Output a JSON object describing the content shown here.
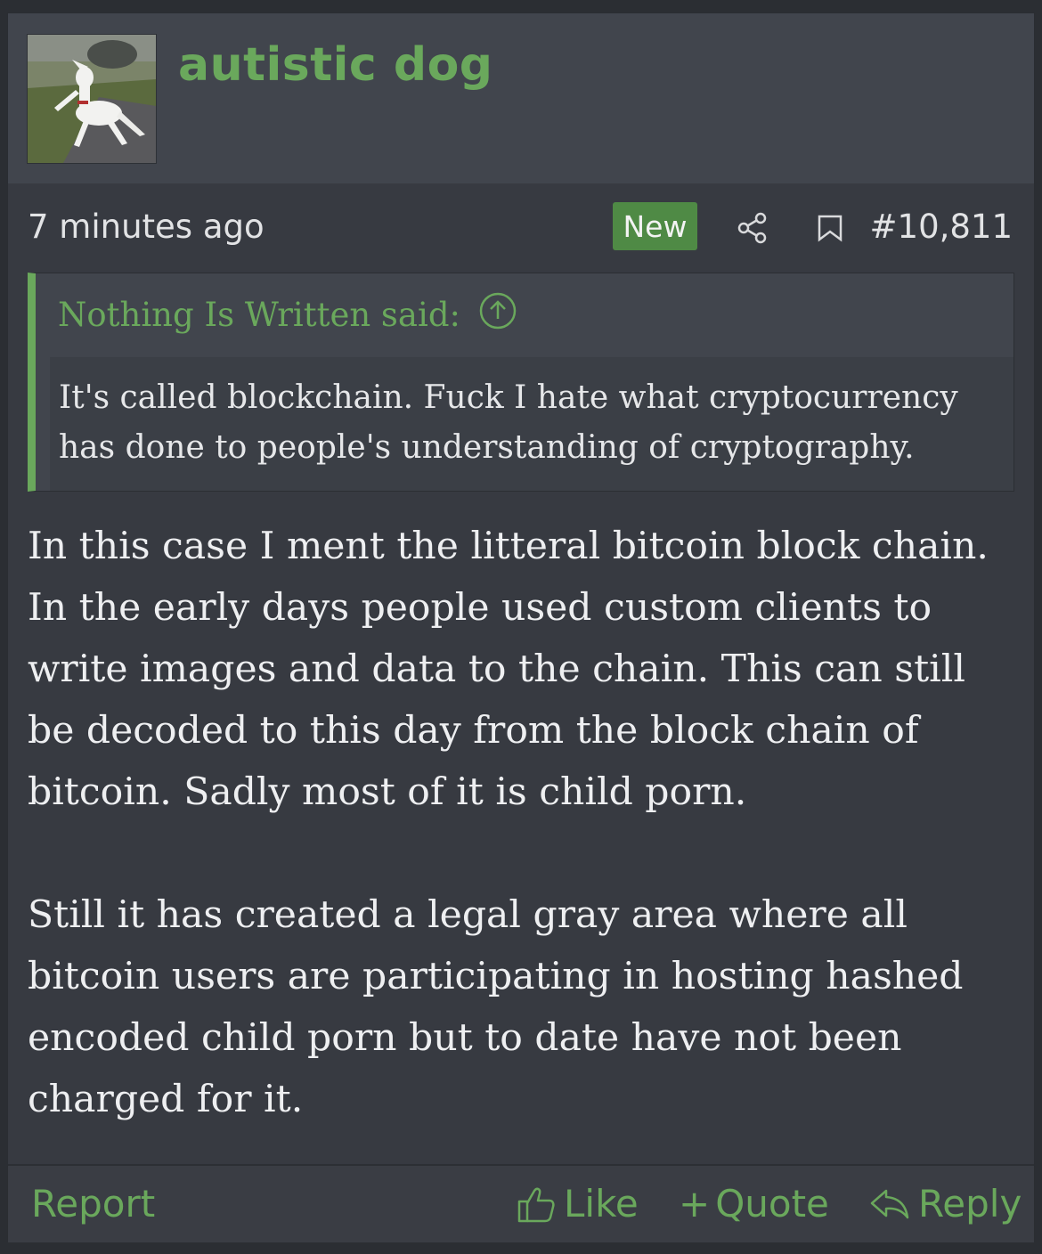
{
  "post": {
    "username": "autistic dog",
    "avatar_alt": "avatar-photo-white-dog",
    "timestamp": "7 minutes ago",
    "new_badge": "New",
    "post_number": "#10,811",
    "quote": {
      "author_line": "Nothing Is Written said:",
      "text": "It's called blockchain. Fuck I hate what cryptocurrency has done to people's understanding of cryptography."
    },
    "body": [
      "In this case I ment the litteral bitcoin block chain. In the early days people used custom clients to write images and data to the chain. This can still be decoded to this day from the block chain of bitcoin. Sadly most of it is child porn.",
      "Still it has created a legal gray area where all bitcoin users are participating in hosting hashed encoded child porn but to date have not been charged for it."
    ],
    "actions": {
      "report": "Report",
      "like": "Like",
      "quote": "Quote",
      "reply": "Reply"
    }
  },
  "colors": {
    "accent": "#6aa85c",
    "new_badge": "#4f8a45",
    "card": "#373a41",
    "header": "#41454d"
  }
}
